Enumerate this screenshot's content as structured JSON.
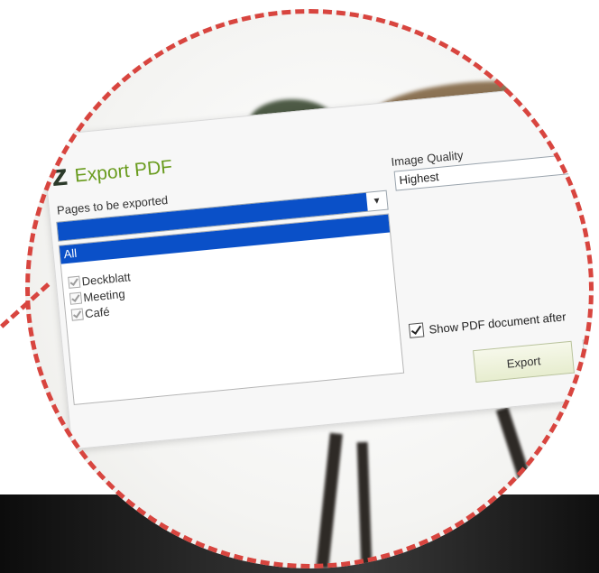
{
  "dialog": {
    "title": "Export PDF",
    "logo_glyph": "Z",
    "pages_label": "Pages to be exported",
    "pages_select_value": "",
    "list": {
      "selected": "All",
      "items": [
        {
          "label": "Deckblatt",
          "checked": true
        },
        {
          "label": "Meeting",
          "checked": true
        },
        {
          "label": "Café",
          "checked": true
        }
      ]
    },
    "image_quality_label": "Image Quality",
    "image_quality_value": "Highest",
    "show_pdf_label": "Show PDF document after",
    "show_pdf_checked": true,
    "export_label": "Export"
  },
  "colors": {
    "accent_green": "#6a9c1f",
    "selection_blue": "#0a50c8",
    "callout_red": "#d8453f"
  }
}
